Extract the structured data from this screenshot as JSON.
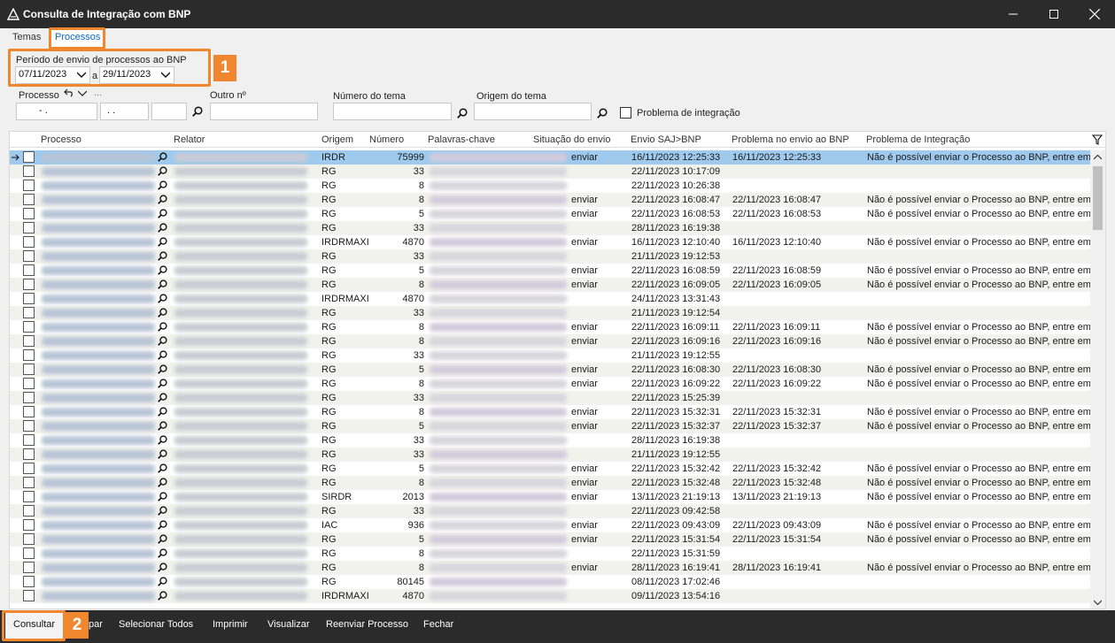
{
  "window": {
    "title": "Consulta de Integração com BNP"
  },
  "tabs": [
    "Temas",
    "Processos"
  ],
  "filters": {
    "periodo_label": "Período de envio de processos ao BNP",
    "date_from": "07/11/2023",
    "date_sep": "a",
    "date_to": "29/11/2023",
    "processo_label": "Processo",
    "processo_value": "-  .",
    "processo_part2": ". .",
    "outro_label": "Outro nº",
    "numero_tema_label": "Número do tema",
    "origem_tema_label": "Origem do tema",
    "problema_label": "Problema de integração",
    "badge_1": "1",
    "badge_2": "2",
    "ellipsis": "..."
  },
  "grid": {
    "headers": [
      "Processo",
      "Relator",
      "Origem",
      "Número",
      "Palavras-chave",
      "Situação do envio",
      "Envio SAJ>BNP",
      "Problema no envio ao BNP",
      "Problema de Integração"
    ],
    "rows": [
      [
        "IRDR",
        "75999",
        "enviar",
        "16/11/2023 12:25:33",
        "16/11/2023 12:25:33",
        "Não é possível enviar o Processo ao BNP, entre em"
      ],
      [
        "RG",
        "33",
        "",
        "22/11/2023 10:17:09",
        "",
        ""
      ],
      [
        "RG",
        "8",
        "",
        "22/11/2023 10:26:38",
        "",
        ""
      ],
      [
        "RG",
        "8",
        "enviar",
        "22/11/2023 16:08:47",
        "22/11/2023 16:08:47",
        "Não é possível enviar o Processo ao BNP, entre em"
      ],
      [
        "RG",
        "5",
        "enviar",
        "22/11/2023 16:08:53",
        "22/11/2023 16:08:53",
        "Não é possível enviar o Processo ao BNP, entre em"
      ],
      [
        "RG",
        "33",
        "",
        "28/11/2023 16:19:38",
        "",
        ""
      ],
      [
        "IRDRMAXI",
        "4870",
        "enviar",
        "16/11/2023 12:10:40",
        "16/11/2023 12:10:40",
        "Não é possível enviar o Processo ao BNP, entre em"
      ],
      [
        "RG",
        "33",
        "",
        "21/11/2023 19:12:53",
        "",
        ""
      ],
      [
        "RG",
        "5",
        "enviar",
        "22/11/2023 16:08:59",
        "22/11/2023 16:08:59",
        "Não é possível enviar o Processo ao BNP, entre em"
      ],
      [
        "RG",
        "8",
        "enviar",
        "22/11/2023 16:09:05",
        "22/11/2023 16:09:05",
        "Não é possível enviar o Processo ao BNP, entre em"
      ],
      [
        "IRDRMAXI",
        "4870",
        "",
        "24/11/2023 13:31:43",
        "",
        ""
      ],
      [
        "RG",
        "33",
        "",
        "21/11/2023 19:12:54",
        "",
        ""
      ],
      [
        "RG",
        "8",
        "enviar",
        "22/11/2023 16:09:11",
        "22/11/2023 16:09:11",
        "Não é possível enviar o Processo ao BNP, entre em"
      ],
      [
        "RG",
        "8",
        "enviar",
        "22/11/2023 16:09:16",
        "22/11/2023 16:09:16",
        "Não é possível enviar o Processo ao BNP, entre em"
      ],
      [
        "RG",
        "33",
        "",
        "21/11/2023 19:12:55",
        "",
        ""
      ],
      [
        "RG",
        "5",
        "enviar",
        "22/11/2023 16:08:30",
        "22/11/2023 16:08:30",
        "Não é possível enviar o Processo ao BNP, entre em"
      ],
      [
        "RG",
        "8",
        "enviar",
        "22/11/2023 16:09:22",
        "22/11/2023 16:09:22",
        "Não é possível enviar o Processo ao BNP, entre em"
      ],
      [
        "RG",
        "33",
        "",
        "22/11/2023 15:25:39",
        "",
        ""
      ],
      [
        "RG",
        "8",
        "enviar",
        "22/11/2023 15:32:31",
        "22/11/2023 15:32:31",
        "Não é possível enviar o Processo ao BNP, entre em"
      ],
      [
        "RG",
        "5",
        "enviar",
        "22/11/2023 15:32:37",
        "22/11/2023 15:32:37",
        "Não é possível enviar o Processo ao BNP, entre em"
      ],
      [
        "RG",
        "33",
        "",
        "28/11/2023 16:19:38",
        "",
        ""
      ],
      [
        "RG",
        "33",
        "",
        "21/11/2023 19:12:55",
        "",
        ""
      ],
      [
        "RG",
        "5",
        "enviar",
        "22/11/2023 15:32:42",
        "22/11/2023 15:32:42",
        "Não é possível enviar o Processo ao BNP, entre em"
      ],
      [
        "RG",
        "8",
        "enviar",
        "22/11/2023 15:32:48",
        "22/11/2023 15:32:48",
        "Não é possível enviar o Processo ao BNP, entre em"
      ],
      [
        "SIRDR",
        "2013",
        "enviar",
        "13/11/2023 21:19:13",
        "13/11/2023 21:19:13",
        "Não é possível enviar o Processo ao BNP, entre em"
      ],
      [
        "RG",
        "33",
        "",
        "22/11/2023 09:42:58",
        "",
        ""
      ],
      [
        "IAC",
        "936",
        "enviar",
        "22/11/2023 09:43:09",
        "22/11/2023 09:43:09",
        "Não é possível enviar o Processo ao BNP, entre em"
      ],
      [
        "RG",
        "5",
        "enviar",
        "22/11/2023 15:31:54",
        "22/11/2023 15:31:54",
        "Não é possível enviar o Processo ao BNP, entre em"
      ],
      [
        "RG",
        "8",
        "",
        "22/11/2023 15:31:59",
        "",
        ""
      ],
      [
        "RG",
        "8",
        "enviar",
        "28/11/2023 16:19:41",
        "28/11/2023 16:19:41",
        "Não é possível enviar o Processo ao BNP, entre em"
      ],
      [
        "RG",
        "80145",
        "",
        "08/11/2023 17:02:46",
        "",
        ""
      ],
      [
        "IRDRMAXI",
        "4870",
        "",
        "09/11/2023 13:54:16",
        "",
        ""
      ]
    ]
  },
  "footer": {
    "buttons": [
      "Consultar",
      "par",
      "Selecionar Todos",
      "Imprimir",
      "Visualizar",
      "Reenviar Processo",
      "Fechar"
    ]
  },
  "colors": {
    "highlight": "#f0872e",
    "selected_row": "#9fcaee",
    "link": "#0a64c8"
  }
}
